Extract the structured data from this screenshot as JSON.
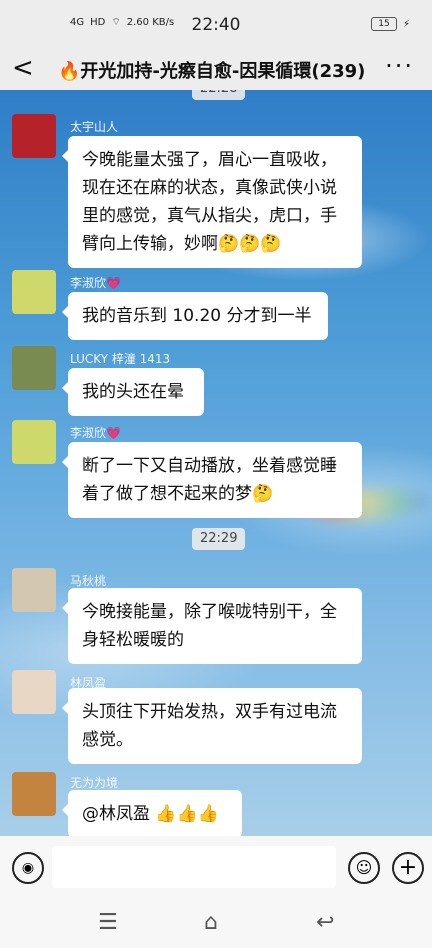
{
  "status": {
    "network": "4G",
    "hd": "HD",
    "wifi": "⌔",
    "speed": "2.60 KB/s",
    "time": "22:40",
    "battery": "15",
    "charging": "⚡"
  },
  "header": {
    "back": "<",
    "title": "🔥开光加持-光瘵自愈-因果循環(239)",
    "more": "···"
  },
  "chat": {
    "top_ts": "22:28",
    "mid_ts": "22:29",
    "messages": [
      {
        "name": "太宇山人",
        "text": "今晚能量太强了，眉心一直吸收，现在还在麻的状态，真像武侠小说里的感觉，真气从指尖，虎口，手臂向上传输，妙啊🤔🤔🤔",
        "avatar_color": "#b5222a"
      },
      {
        "name": "李淑欣💗",
        "text": "我的音乐到 10.20 分才到一半",
        "avatar_color": "#cfd96b"
      },
      {
        "name": "LUCKY 梓潼 1413",
        "text": "我的头还在晕",
        "avatar_color": "#7a8b52"
      },
      {
        "name": "李淑欣💗",
        "text": "断了一下又自动播放，坐着感觉睡着了做了想不起来的梦🤔",
        "avatar_color": "#cfd96b"
      },
      {
        "name": "马秋桃",
        "text": "今晚接能量，除了喉咙特别干，全身轻松暖暖的",
        "avatar_color": "#d4c7b2"
      },
      {
        "name": "林凤盈",
        "text": "头顶往下开始发热，双手有过电流感觉。",
        "avatar_color": "#e8d7c5"
      },
      {
        "name": "无为为境",
        "text": "@林凤盈 👍👍👍",
        "avatar_color": "#c2843e"
      }
    ]
  },
  "bottom": {
    "voice": "◉",
    "emoji": "☺",
    "plus": "+",
    "nav_menu": "☰",
    "nav_home": "⌂",
    "nav_back": "↩"
  }
}
